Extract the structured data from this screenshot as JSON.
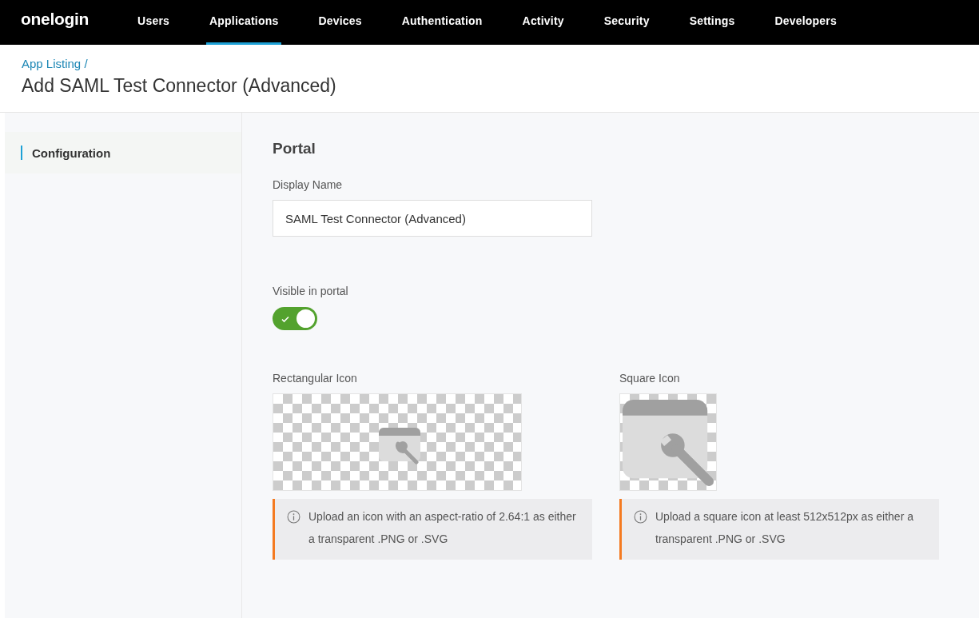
{
  "nav": {
    "logo": "onelogin",
    "items": [
      {
        "label": "Users",
        "selected": false
      },
      {
        "label": "Applications",
        "selected": true
      },
      {
        "label": "Devices",
        "selected": false
      },
      {
        "label": "Authentication",
        "selected": false
      },
      {
        "label": "Activity",
        "selected": false
      },
      {
        "label": "Security",
        "selected": false
      },
      {
        "label": "Settings",
        "selected": false
      },
      {
        "label": "Developers",
        "selected": false
      }
    ]
  },
  "header": {
    "breadcrumb": "App Listing /",
    "title": "Add SAML Test Connector (Advanced)"
  },
  "sidebar": {
    "items": [
      {
        "label": "Configuration",
        "selected": true
      }
    ]
  },
  "portal": {
    "heading": "Portal",
    "display_name": {
      "label": "Display Name",
      "value": "SAML Test Connector (Advanced)"
    },
    "visible": {
      "label": "Visible in portal",
      "on": true
    },
    "icons": [
      {
        "kind": "rectangular",
        "label": "Rectangular Icon",
        "hint": "Upload an icon with an aspect-ratio of 2.64:1 as either a transparent .PNG or .SVG"
      },
      {
        "kind": "square",
        "label": "Square Icon",
        "hint": "Upload a square icon at least 512x512px as either a transparent .PNG or .SVG"
      }
    ]
  }
}
